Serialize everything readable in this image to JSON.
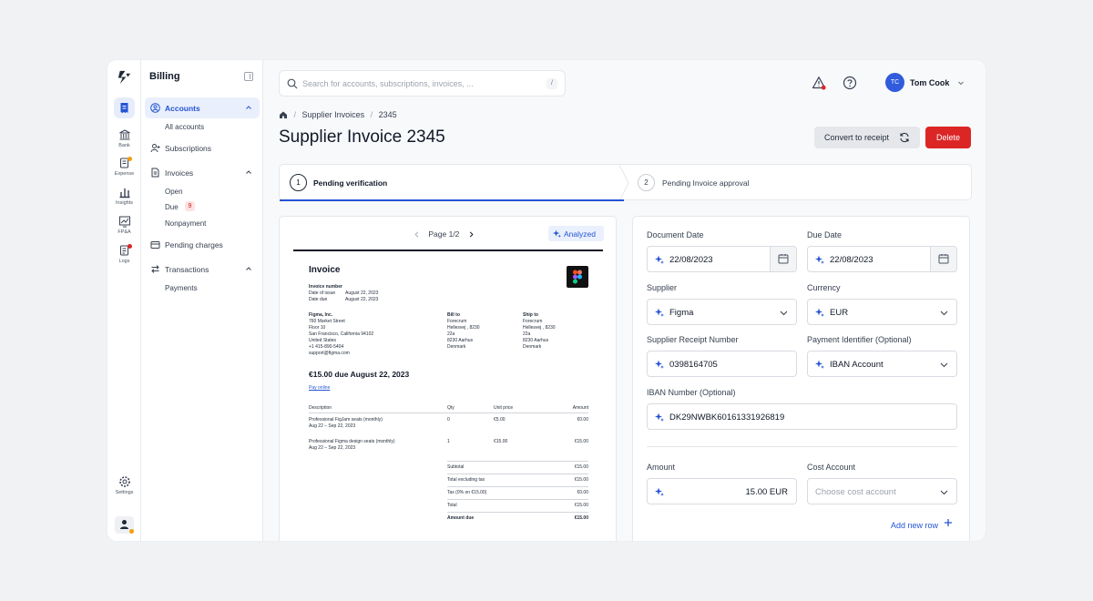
{
  "rail": {
    "items": [
      {
        "label": "Bank"
      },
      {
        "label": "Expense"
      },
      {
        "label": "Insights"
      },
      {
        "label": "FP&A"
      },
      {
        "label": "Logs"
      },
      {
        "label": "Settings"
      }
    ]
  },
  "nav": {
    "title": "Billing",
    "accounts": "Accounts",
    "all_accounts": "All accounts",
    "subscriptions": "Subscriptions",
    "invoices": "Invoices",
    "open": "Open",
    "due": "Due",
    "due_count": "9",
    "nonpayment": "Nonpayment",
    "pending_charges": "Pending charges",
    "transactions": "Transactions",
    "payments": "Payments"
  },
  "topbar": {
    "search_placeholder": "Search for accounts, subscriptions, invoices, ...",
    "search_shortcut": "/",
    "user_initials": "TC",
    "user_name": "Tom Cook"
  },
  "breadcrumb": [
    "Supplier Invoices",
    "2345"
  ],
  "page": {
    "title": "Supplier Invoice 2345",
    "convert_label": "Convert to receipt",
    "delete_label": "Delete"
  },
  "steps": [
    {
      "num": "1",
      "label": "Pending verification"
    },
    {
      "num": "2",
      "label": "Pending Invoice approval"
    }
  ],
  "preview": {
    "page_label": "Page 1/2",
    "analyzed_label": "Analyzed",
    "invoice": {
      "title": "Invoice",
      "number_label": "Invoice number",
      "issue_label": "Date of issue",
      "issue_value": "August 22, 2023",
      "due_label": "Date due",
      "due_value": "August 22, 2023",
      "from": [
        "Figma, Inc.",
        "760 Market Street",
        "Floor 10",
        "San Francisco, California 94102",
        "United States",
        "+1 415-890-5404",
        "support@figma.com"
      ],
      "bill_to_label": "Bill to",
      "bill_to": [
        "Forecrum",
        "Hellesvej , 8230",
        "22a",
        "8230 Aarhus",
        "Denmark"
      ],
      "ship_to_label": "Ship to",
      "ship_to": [
        "Forecrum",
        "Hellesvej , 8230",
        "22a",
        "8230 Aarhus",
        "Denmark"
      ],
      "amount_due_heading": "€15.00 due August 22, 2023",
      "pay_link": "Pay online",
      "columns": [
        "Description",
        "Qty",
        "Unit price",
        "Amount"
      ],
      "lines": [
        {
          "desc": "Professional FigJam seats (monthly)",
          "period": "Aug 22 – Sep 22, 2023",
          "qty": "0",
          "unit": "€5.00",
          "amount": "€0.00"
        },
        {
          "desc": "Professional Figma design seats (monthly)",
          "period": "Aug 22 – Sep 22, 2023",
          "qty": "1",
          "unit": "€15.00",
          "amount": "€15.00"
        }
      ],
      "totals": [
        {
          "label": "Subtotal",
          "value": "€15.00"
        },
        {
          "label": "Total excluding tax",
          "value": "€15.00"
        },
        {
          "label": "Tax (0% on €15.00)",
          "value": "€0.00"
        },
        {
          "label": "Total",
          "value": "€15.00"
        },
        {
          "label": "Amount due",
          "value": "€15.00"
        }
      ]
    }
  },
  "form": {
    "document_date_label": "Document Date",
    "document_date": "22/08/2023",
    "due_date_label": "Due Date",
    "due_date": "22/08/2023",
    "supplier_label": "Supplier",
    "supplier": "Figma",
    "currency_label": "Currency",
    "currency": "EUR",
    "receipt_number_label": "Supplier Receipt Number",
    "receipt_number": "0398164705",
    "payment_identifier_label": "Payment Identifier (Optional)",
    "payment_identifier": "IBAN Account",
    "iban_label": "IBAN Number (Optional)",
    "iban": "DK29NWBK60161331926819",
    "amount_label": "Amount",
    "amount": "15.00 EUR",
    "cost_account_label": "Cost Account",
    "cost_account_placeholder": "Choose cost account",
    "add_row_label": "Add new row"
  },
  "colors": {
    "accent": "#2454d6",
    "danger": "#dc2626",
    "warning_dot": "#f59e0b"
  }
}
